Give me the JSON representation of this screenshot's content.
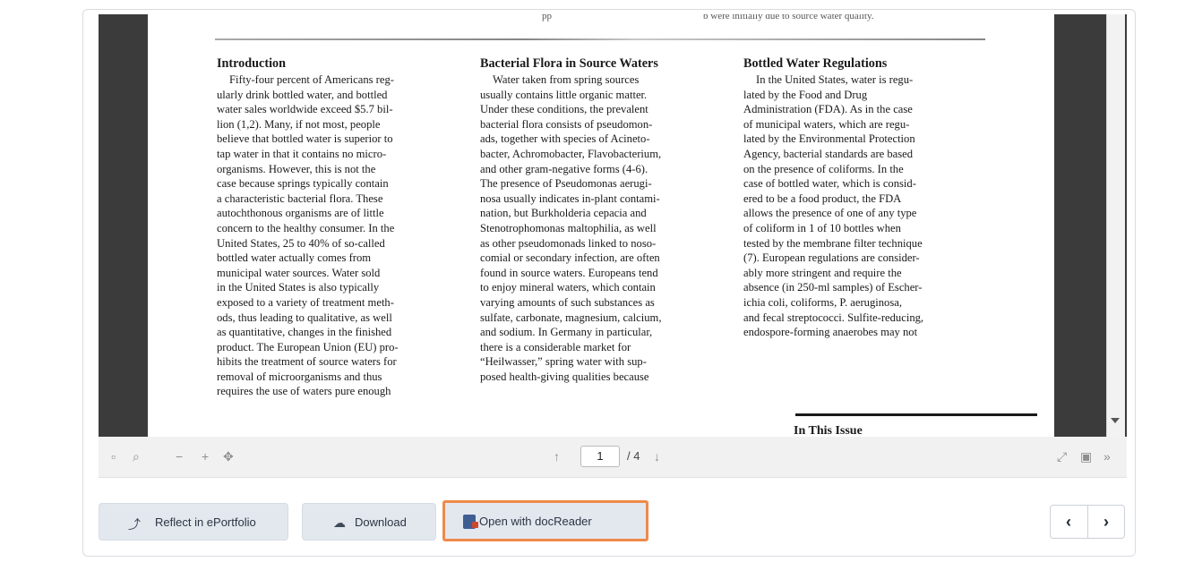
{
  "document": {
    "top_snippet_left": "pp",
    "top_snippet_right": "b were initially due to source water quality.",
    "columns": [
      {
        "heading": "Introduction",
        "lines": [
          "Fifty-four percent of Americans reg-",
          "ularly drink bottled water, and bottled",
          "water sales worldwide exceed $5.7 bil-",
          "lion (1,2). Many, if not most, people",
          "believe that bottled water is superior to",
          "tap water in that it contains no micro-",
          "organisms. However, this is not the",
          "case because springs typically contain",
          "a characteristic bacterial flora. These",
          "autochthonous organisms are of little",
          "concern to the healthy consumer. In the",
          "United States, 25 to 40% of so-called",
          "bottled water actually comes from",
          "municipal water sources. Water sold",
          "in the United States is also typically",
          "exposed to a variety of treatment meth-",
          "ods, thus leading to qualitative, as well",
          "as quantitative, changes in the finished",
          "product. The European Union (EU) pro-",
          "hibits the treatment of source waters for",
          "removal of microorganisms and thus",
          "requires the use of waters pure enough"
        ]
      },
      {
        "heading": "Bacterial Flora in Source Waters",
        "lines": [
          "Water taken from spring sources",
          "usually contains little organic matter.",
          "Under these conditions, the prevalent",
          "bacterial flora consists of pseudomon-",
          "ads, together with species of Acineto-",
          "bacter, Achromobacter, Flavobacterium,",
          "and other gram-negative forms (4-6).",
          "The presence of Pseudomonas aerugi-",
          "nosa usually indicates in-plant contami-",
          "nation, but Burkholderia cepacia and",
          "Stenotrophomonas maltophilia, as well",
          "as other pseudomonads linked to noso-",
          "comial or secondary infection, are often",
          "found in source waters. Europeans tend",
          "to enjoy mineral waters, which contain",
          "varying amounts of such substances as",
          "sulfate, carbonate, magnesium, calcium,",
          "and sodium. In Germany in particular,",
          "there is a considerable market for",
          "“Heilwasser,” spring water with sup-",
          "posed health-giving qualities because"
        ]
      },
      {
        "heading": "Bottled Water Regulations",
        "lines": [
          "In the United States, water is regu-",
          "lated by the Food and Drug",
          "Administration (FDA). As in the case",
          "of municipal waters, which are regu-",
          "lated by the Environmental Protection",
          "Agency, bacterial standards are based",
          "on the presence of coliforms. In the",
          "case of bottled water, which is consid-",
          "ered to be a food product, the FDA",
          "allows the presence of one of any type",
          "of coliform in 1 of 10 bottles when",
          "tested by the membrane filter technique",
          "(7). European regulations are consider-",
          "ably more stringent and require the",
          "absence (in 250-ml samples) of Escher-",
          "ichia coli, coliforms, P. aeruginosa,",
          "and fecal streptococci. Sulfite-reducing,",
          "endospore-forming anaerobes may not"
        ]
      }
    ],
    "in_this_issue": "In This Issue"
  },
  "toolbar": {
    "sidebar_icon": "▫",
    "search_icon": "⌕",
    "zoom_out": "−",
    "zoom_in": "+",
    "fit_icon": "✥",
    "prev_page": "↑",
    "next_page": "↓",
    "current_page": "1",
    "total_pages": "/ 4",
    "fullscreen_icon": "⤢",
    "save_icon": "▣",
    "more_icon": "»"
  },
  "actions": {
    "reflect": "Reflect in ePortfolio",
    "download": "Download",
    "open_docreader": "Open with docReader"
  },
  "nav": {
    "prev": "‹",
    "next": "›"
  },
  "colors": {
    "highlight": "#ee8a4a",
    "button_bg": "#e3e8ef",
    "viewer_bg": "#3b3b3b"
  }
}
